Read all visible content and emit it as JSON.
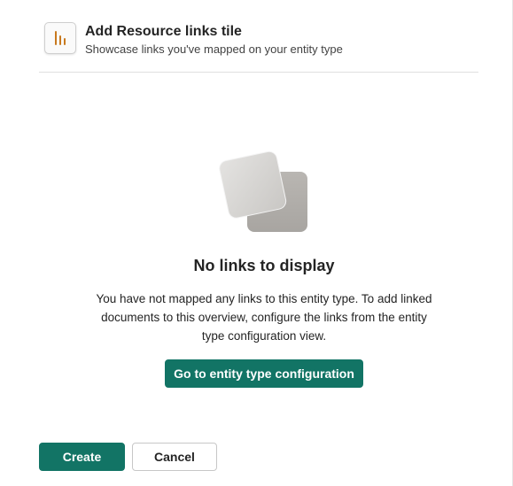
{
  "header": {
    "icon": "bar-chart-icon",
    "title": "Add Resource links tile",
    "subtitle": "Showcase links you've mapped on your entity type"
  },
  "empty_state": {
    "illustration": "stacked-squares-icon",
    "heading": "No links to display",
    "body": "You have not mapped any links to this entity type. To add linked documents to this overview, configure the links from the entity type configuration view.",
    "action_label": "Go to entity type configuration"
  },
  "footer": {
    "create_label": "Create",
    "cancel_label": "Cancel"
  },
  "colors": {
    "primary": "#127465",
    "icon_accent": "#c8791e"
  }
}
